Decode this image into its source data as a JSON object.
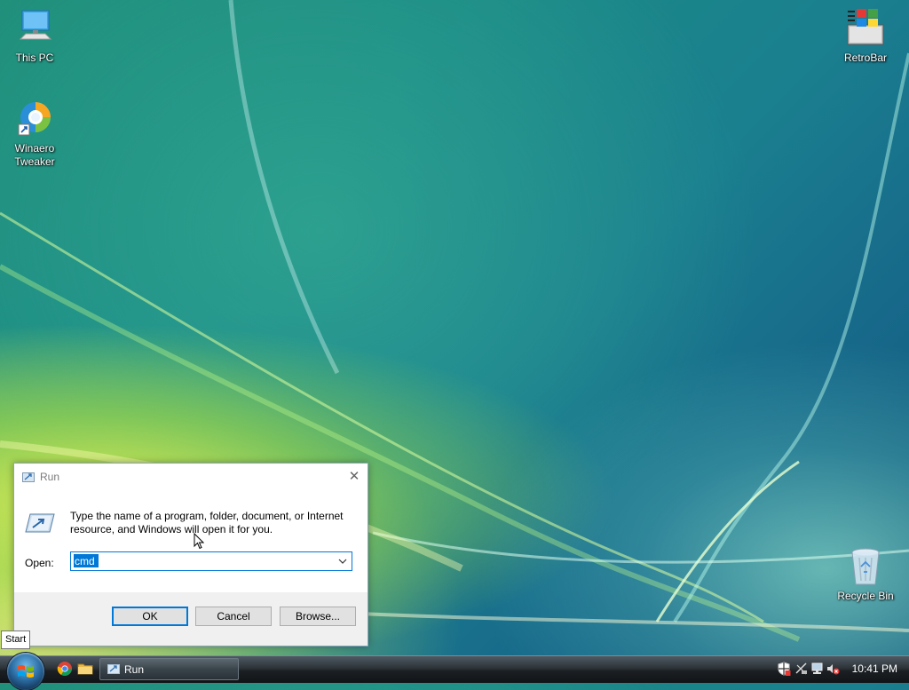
{
  "desktop": {
    "icons": [
      {
        "label": "This PC",
        "icon": "this-pc-icon"
      },
      {
        "label": "Winaero Tweaker",
        "icon": "winaero-tweaker-icon"
      },
      {
        "label": "RetroBar",
        "icon": "retrobar-icon"
      },
      {
        "label": "Recycle Bin",
        "icon": "recycle-bin-icon"
      }
    ]
  },
  "run_dialog": {
    "title": "Run",
    "close_glyph": "✕",
    "description": "Type the name of a program, folder, document, or Internet resource, and Windows will open it for you.",
    "open_label": "Open:",
    "input_value": "cmd",
    "buttons": {
      "ok": "OK",
      "cancel": "Cancel",
      "browse": "Browse..."
    }
  },
  "tooltip": "Start",
  "taskbar": {
    "quick_launch": [
      "chrome-icon",
      "file-explorer-icon"
    ],
    "tasks": [
      {
        "label": "Run",
        "icon": "run-icon"
      }
    ],
    "tray_icons": [
      "security-shield-icon",
      "network-disconnected-icon",
      "display-network-icon",
      "volume-muted-icon"
    ],
    "clock": "10:41 PM"
  },
  "colors": {
    "accent": "#0078d7",
    "selection": "#0078d7",
    "taskbar": "#1b1f23"
  }
}
